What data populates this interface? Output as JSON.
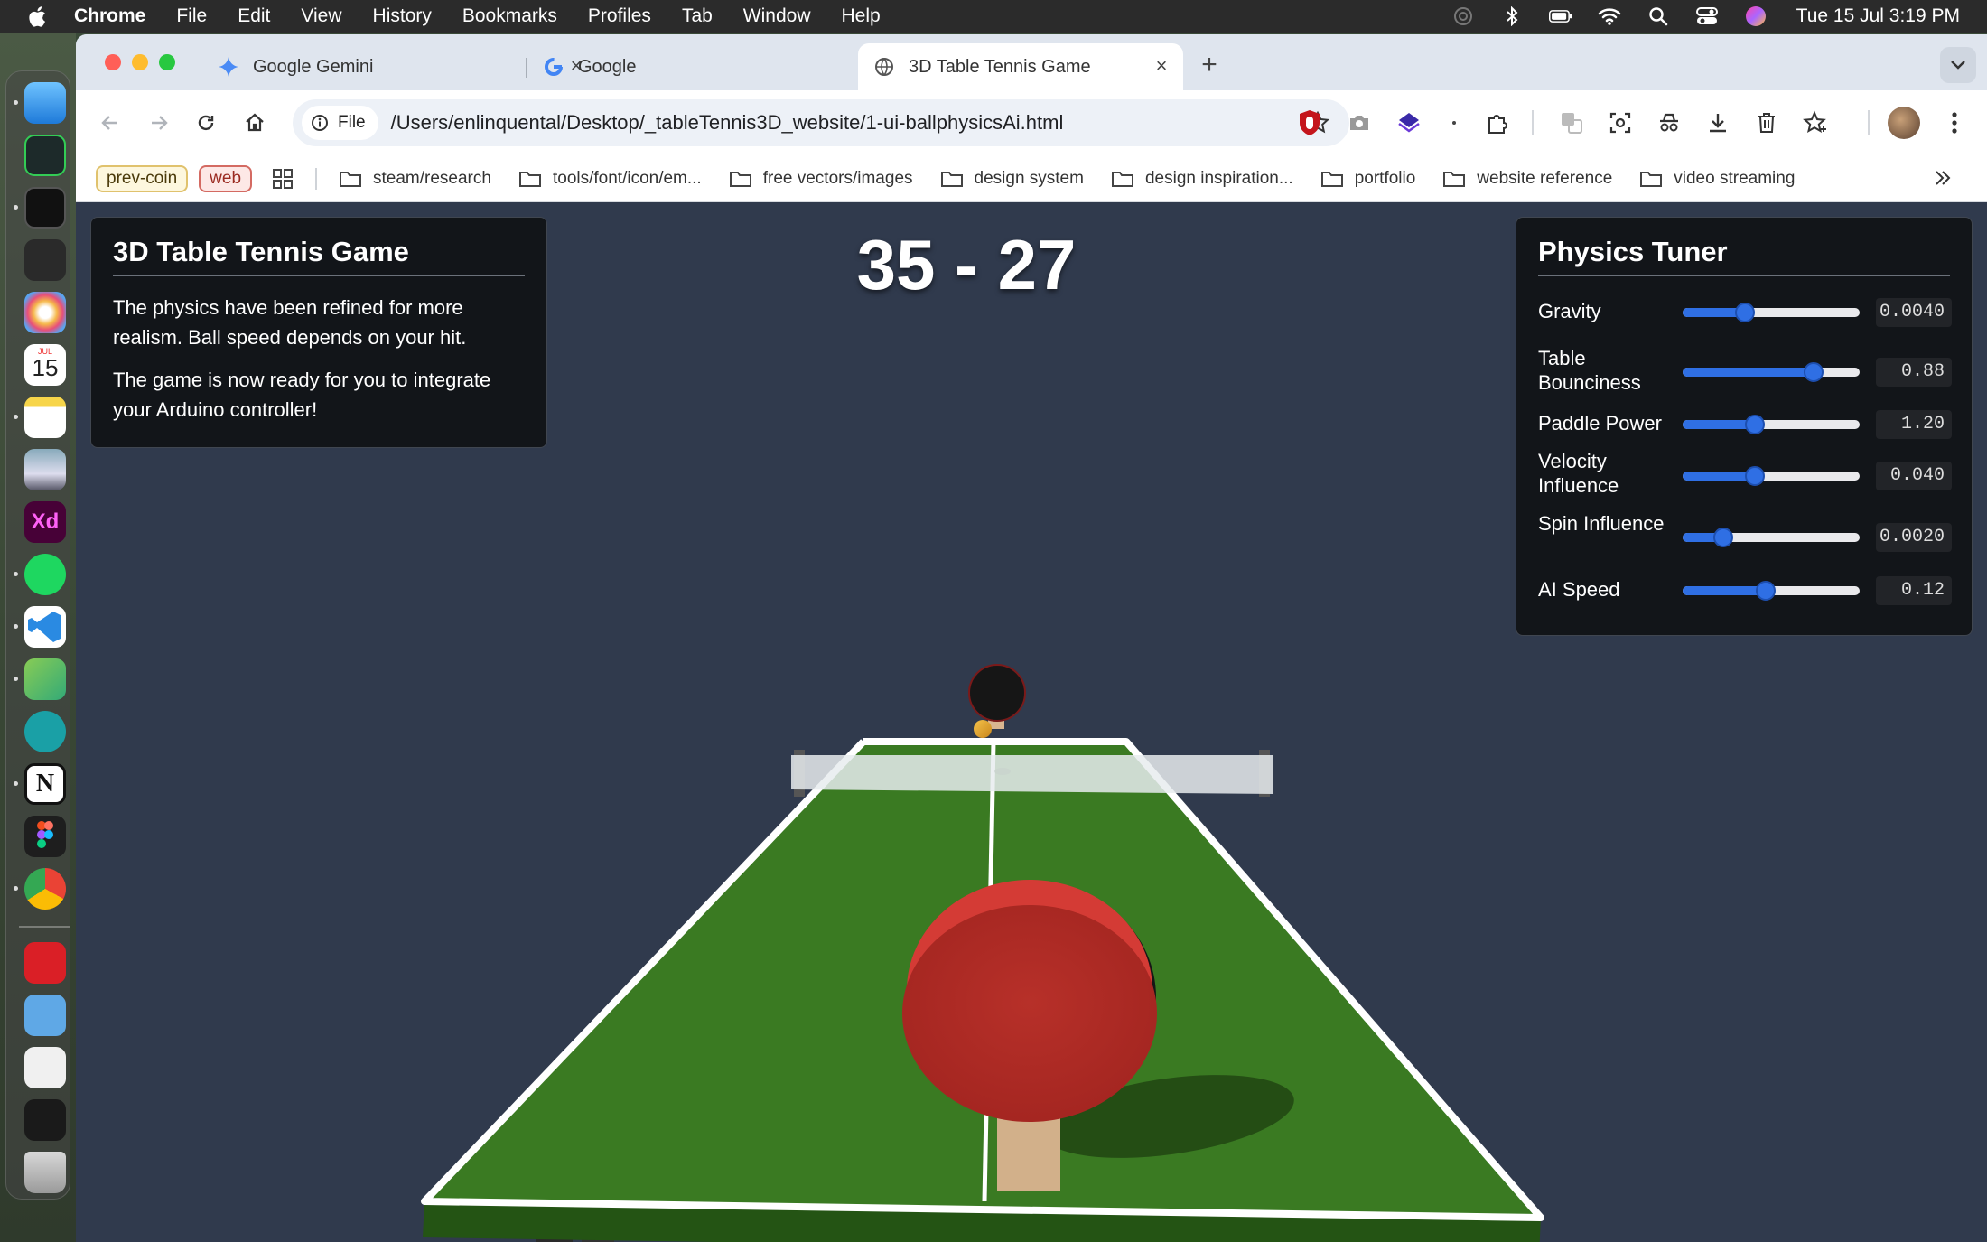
{
  "menubar": {
    "app_name": "Chrome",
    "items": [
      "File",
      "Edit",
      "View",
      "History",
      "Bookmarks",
      "Profiles",
      "Tab",
      "Window",
      "Help"
    ],
    "clock": "Tue 15 Jul  3:19 PM"
  },
  "tabs": [
    {
      "title": "Google Gemini",
      "icon": "gemini-icon"
    },
    {
      "title": "Google",
      "icon": "google-icon"
    },
    {
      "title": "3D Table Tennis Game",
      "icon": "globe-icon",
      "active": true
    }
  ],
  "address_bar": {
    "chip_label": "File",
    "url": "/Users/enlinquental/Desktop/_tableTennis3D_website/1-ui-ballphysicsAi.html"
  },
  "bookmarks": {
    "pills": [
      "prev-coin",
      "web"
    ],
    "folders": [
      "steam/research",
      "tools/font/icon/em...",
      "free vectors/images",
      "design system",
      "design inspiration...",
      "portfolio",
      "website reference",
      "video streaming"
    ]
  },
  "dock": {
    "calendar_day": "15",
    "calendar_month": "JUL"
  },
  "game": {
    "info_title": "3D Table Tennis Game",
    "info_paragraph_1": "The physics have been refined for more realism. Ball speed depends on your hit.",
    "info_paragraph_2": "The game is now ready for you to integrate your Arduino controller!",
    "score": "35 - 27"
  },
  "tuner": {
    "title": "Physics Tuner",
    "params": [
      {
        "label": "Gravity",
        "value": "0.0040",
        "level": 0.35
      },
      {
        "label": "Table Bounciness",
        "value": "0.88",
        "level": 0.74
      },
      {
        "label": "Paddle Power",
        "value": "1.20",
        "level": 0.41
      },
      {
        "label": "Velocity Influence",
        "value": "0.040",
        "level": 0.41
      },
      {
        "label": "Spin Influence",
        "value": "0.0020",
        "level": 0.23
      },
      {
        "label": "AI Speed",
        "value": "0.12",
        "level": 0.47
      }
    ]
  },
  "colors": {
    "accent": "#2f6fe4",
    "table_green": "#3a7a22",
    "paddle_red": "#b5302b",
    "background": "#303a4d"
  }
}
